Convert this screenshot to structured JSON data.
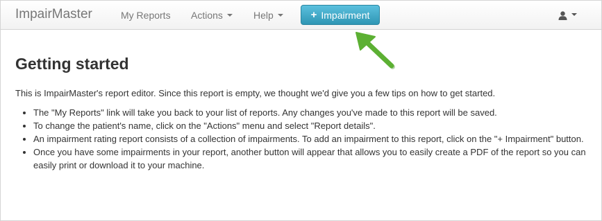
{
  "navbar": {
    "brand": "ImpairMaster",
    "my_reports": "My Reports",
    "actions": "Actions",
    "help": "Help",
    "add_impairment": {
      "icon": "plus-icon",
      "label": "Impairment"
    },
    "user_menu": {
      "icon": "user-icon"
    }
  },
  "main": {
    "title": "Getting started",
    "intro": "This is ImpairMaster's report editor. Since this report is empty, we thought we'd give you a few tips on how to get started.",
    "tips": [
      "The \"My Reports\" link will take you back to your list of reports. Any changes you've made to this report will be saved.",
      "To change the patient's name, click on the \"Actions\" menu and select \"Report details\".",
      "An impairment rating report consists of a collection of impairments. To add an impairment to this report, click on the \"+ Impairment\" button.",
      "Once you have some impairments in your report, another button will appear that allows you to easily create a PDF of the report so you can easily print or download it to your machine."
    ]
  },
  "annotation": {
    "icon": "green-arrow-icon",
    "color": "#5cb033"
  },
  "colors": {
    "accent": "#49afcd",
    "nav_text": "#777777"
  }
}
